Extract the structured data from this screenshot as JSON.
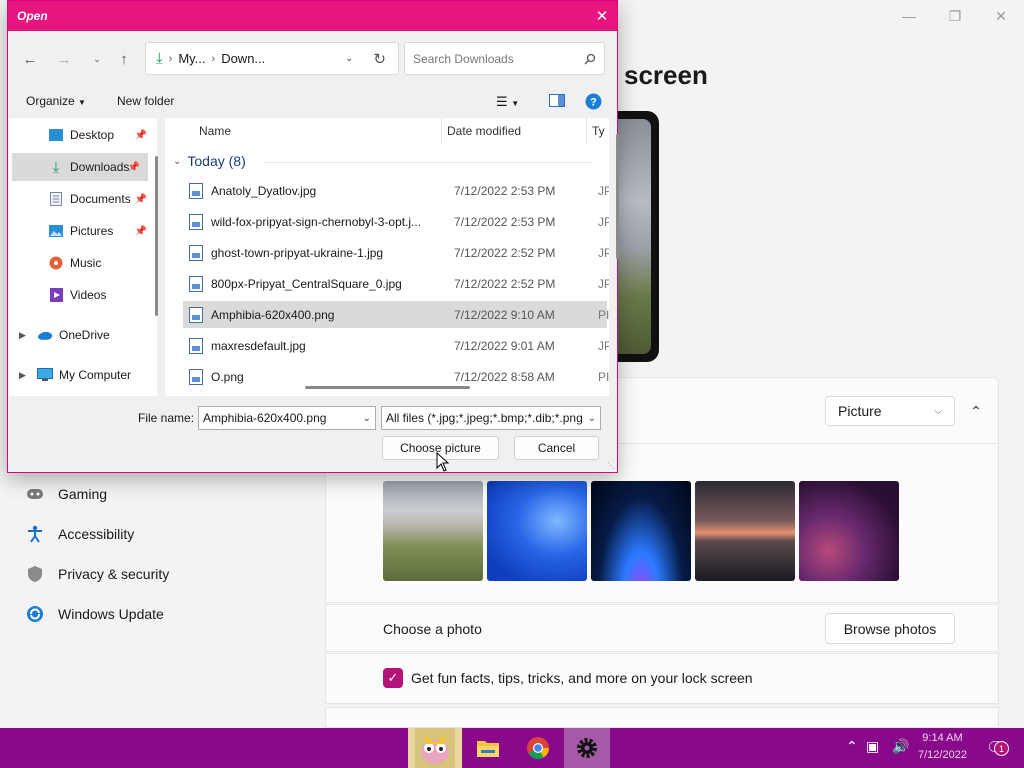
{
  "settings": {
    "page_title": "screen",
    "nav": [
      {
        "label": "Gaming",
        "icon": "gamepad-icon"
      },
      {
        "label": "Accessibility",
        "icon": "accessibility-icon"
      },
      {
        "label": "Privacy & security",
        "icon": "shield-icon"
      },
      {
        "label": "Windows Update",
        "icon": "update-icon"
      }
    ],
    "background_dropdown": "Picture",
    "choose_photo_label": "Choose a photo",
    "browse_button": "Browse photos",
    "fun_facts_label": "Get fun facts, tips, tricks, and more on your lock screen",
    "fun_facts_checked": true
  },
  "dialog": {
    "title": "Open",
    "breadcrumb": [
      "My...",
      "Down..."
    ],
    "search_placeholder": "Search Downloads",
    "organize_label": "Organize",
    "new_folder_label": "New folder",
    "tree": [
      {
        "label": "Desktop",
        "icon": "desktop-icon",
        "pinned": true
      },
      {
        "label": "Downloads",
        "icon": "download-icon",
        "pinned": true,
        "selected": true
      },
      {
        "label": "Documents",
        "icon": "document-icon",
        "pinned": true
      },
      {
        "label": "Pictures",
        "icon": "pictures-icon",
        "pinned": true
      },
      {
        "label": "Music",
        "icon": "music-icon"
      },
      {
        "label": "Videos",
        "icon": "video-icon"
      },
      {
        "label": "OneDrive",
        "icon": "cloud-icon"
      },
      {
        "label": "My Computer",
        "icon": "computer-icon"
      }
    ],
    "columns": {
      "name": "Name",
      "date": "Date modified",
      "type": "Ty"
    },
    "group_label": "Today (8)",
    "files": [
      {
        "name": "Anatoly_Dyatlov.jpg",
        "date": "7/12/2022 2:53 PM",
        "type": "JP"
      },
      {
        "name": "wild-fox-pripyat-sign-chernobyl-3-opt.j...",
        "date": "7/12/2022 2:53 PM",
        "type": "JP"
      },
      {
        "name": "ghost-town-pripyat-ukraine-1.jpg",
        "date": "7/12/2022 2:52 PM",
        "type": "JP"
      },
      {
        "name": "800px-Pripyat_CentralSquare_0.jpg",
        "date": "7/12/2022 2:52 PM",
        "type": "JP"
      },
      {
        "name": "Amphibia-620x400.png",
        "date": "7/12/2022 9:10 AM",
        "type": "PI",
        "selected": true
      },
      {
        "name": "maxresdefault.jpg",
        "date": "7/12/2022 9:01 AM",
        "type": "JP"
      },
      {
        "name": "O.png",
        "date": "7/12/2022 8:58 AM",
        "type": "PI"
      }
    ],
    "file_name_label": "File name:",
    "file_name_value": "Amphibia-620x400.png",
    "file_type_value": "All files (*.jpg;*.jpeg;*.bmp;*.dib;*.png",
    "choose_button": "Choose picture",
    "cancel_button": "Cancel"
  },
  "taskbar": {
    "time": "9:14 AM",
    "date": "7/12/2022",
    "notification_count": "1"
  }
}
